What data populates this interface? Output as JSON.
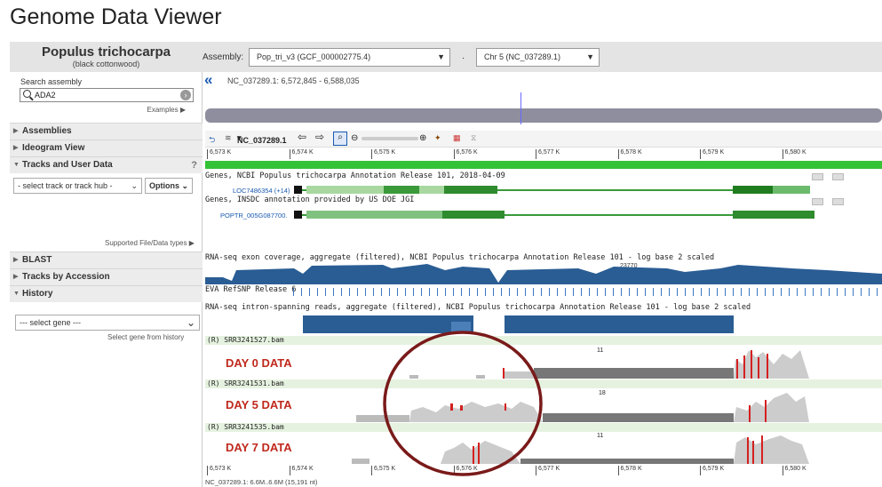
{
  "page_title": "Genome Data Viewer",
  "organism": {
    "name": "Populus trichocarpa",
    "common": "(black cottonwood)"
  },
  "search": {
    "label": "Search assembly",
    "value": "ADA2",
    "examples": "Examples ▶"
  },
  "sidebar": {
    "assemblies": "Assemblies",
    "ideogram": "Ideogram View",
    "tracks": "Tracks and User Data",
    "tracks_help": "?",
    "track_select": "- select track or track hub -",
    "options": "Options",
    "supported": "Supported File/Data types",
    "blast": "BLAST",
    "by_accession": "Tracks by Accession",
    "history": "History",
    "gene_select": "--- select gene ---",
    "gene_hint": "Select gene from history"
  },
  "header": {
    "assembly_label": "Assembly:",
    "assembly_value": "Pop_tri_v3 (GCF_000002775.4)",
    "separator": "·",
    "chr_value": "Chr 5 (NC_037289.1)"
  },
  "location": "NC_037289.1: 6,572,845 - 6,588,035",
  "toolbar": {
    "seq": "NC_037289.1"
  },
  "ruler_ticks": [
    "6,573 K",
    "6,574 K",
    "6,575 K",
    "6,576 K",
    "6,577 K",
    "6,578 K",
    "6,579 K",
    "6,580 K"
  ],
  "tracks": {
    "ncbi_genes": "Genes, NCBI Populus trichocarpa Annotation Release 101, 2018-04-09",
    "ncbi_gene_label": "LOC7486354 (+14)",
    "jgi_genes": "Genes, INSDC annotation provided by US DOE JGI",
    "jgi_gene_label": "POPTR_005G087700.",
    "rnaseq_cov": "RNA-seq exon coverage, aggregate (filtered), NCBI Populus trichocarpa Annotation Release 101 - log base 2 scaled",
    "cov_max": "23770",
    "eva": "EVA RefSNP Release 6",
    "rnaseq_intron": "RNA-seq intron-spanning reads, aggregate (filtered), NCBI Populus trichocarpa Annotation Release 101 - log base 2 scaled"
  },
  "bams": [
    {
      "header": "(R) SRR3241527.bam",
      "label": "DAY 0 DATA",
      "max": "11"
    },
    {
      "header": "(R) SRR3241531.bam",
      "label": "DAY 5 DATA",
      "max": "18"
    },
    {
      "header": "(R) SRR3241535.bam",
      "label": "DAY 7 DATA",
      "max": "11"
    }
  ],
  "footer": "NC_037289.1: 6.6M..6.6M (15,191 nt)",
  "colors": {
    "annotation_circle": "#7a1a1a",
    "gene_green": "#2e8b2e",
    "coverage_blue": "#2a5d94",
    "mismatch_red": "#d42020"
  }
}
